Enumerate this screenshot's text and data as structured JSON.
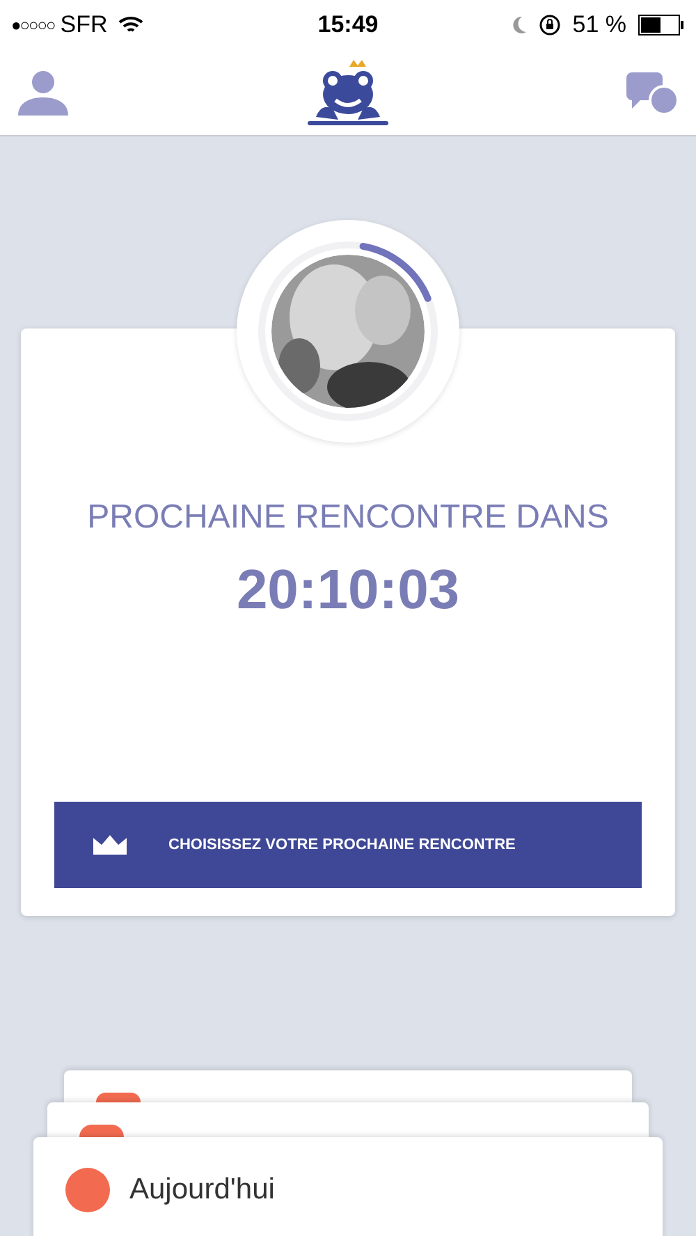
{
  "status_bar": {
    "signal": "●○○○○",
    "carrier": "SFR",
    "time": "15:49",
    "battery_percent": "51 %"
  },
  "countdown": {
    "progress": {
      "level": 0.16
    },
    "title": "PROCHAINE RENCONTRE DANS",
    "time": "20:10:03",
    "button": "CHOISISSEZ VOTRE PROCHAINE RENCONTRE"
  },
  "stack": [
    {
      "color": "#f26b50"
    },
    {
      "color": "#f26b50"
    },
    {
      "color": "#f26b50",
      "label": "Aujourd'hui"
    }
  ]
}
